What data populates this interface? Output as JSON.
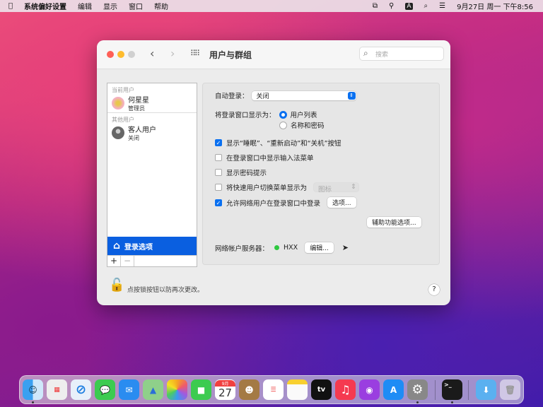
{
  "menubar": {
    "app": "系统偏好设置",
    "items": [
      "编辑",
      "显示",
      "窗口",
      "帮助"
    ],
    "clock": "9月27日 周一 下午8:56",
    "input_badge": "A"
  },
  "window": {
    "title": "用户与群组",
    "search_placeholder": "搜索"
  },
  "sidebar": {
    "current_header": "当前用户",
    "current_user": {
      "name": "何星星",
      "role": "管理员"
    },
    "other_header": "其他用户",
    "other_user": {
      "name": "客人用户",
      "role": "关闭"
    },
    "selected": "登录选项",
    "add": "+",
    "remove": "−"
  },
  "options": {
    "auto_login_label": "自动登录：",
    "auto_login_value": "关闭",
    "display_label": "将登录窗口显示为：",
    "radio": [
      {
        "label": "用户列表",
        "selected": true
      },
      {
        "label": "名称和密码",
        "selected": false
      }
    ],
    "checks": [
      {
        "label": "显示“睡眠”、“重新启动”和“关机”按钮",
        "checked": true
      },
      {
        "label": "在登录窗口中显示输入法菜单",
        "checked": false
      },
      {
        "label": "显示密码提示",
        "checked": false
      },
      {
        "label": "将快速用户切换菜单显示为",
        "checked": false
      },
      {
        "label": "允许网络用户在登录窗口中登录",
        "checked": true
      }
    ],
    "fast_switch_value": "图标",
    "options_button": "选项...",
    "accessibility_button": "辅助功能选项...",
    "network_label": "网络帐户服务器：",
    "network_server": "HXX",
    "network_status_color": "#2ec840",
    "edit_button": "编辑..."
  },
  "footer": {
    "lock_text": "点按锁按钮以防再次更改。",
    "help": "?"
  },
  "dock": {
    "calendar_month": "9月",
    "calendar_day": "27",
    "tv_label": "tv",
    "items": [
      "finder",
      "launchpad",
      "safari",
      "messages",
      "mail",
      "maps",
      "photos",
      "facetime",
      "calendar",
      "contacts",
      "reminders",
      "notes",
      "tv",
      "music",
      "podcasts",
      "app-store",
      "system-preferences",
      "terminal",
      "downloads",
      "trash"
    ]
  }
}
